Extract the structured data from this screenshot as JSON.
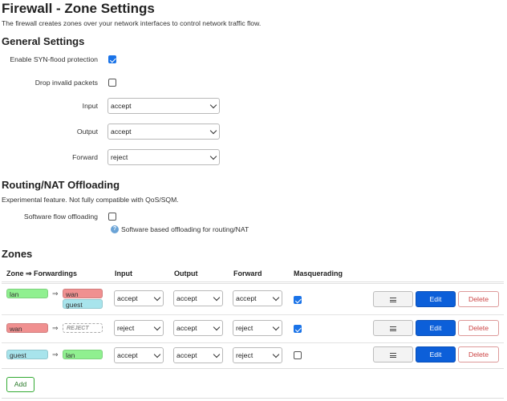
{
  "page": {
    "title": "Firewall - Zone Settings",
    "description": "The firewall creates zones over your network interfaces to control network traffic flow."
  },
  "general": {
    "heading": "General Settings",
    "syn_flood_label": "Enable SYN-flood protection",
    "syn_flood_checked": true,
    "drop_invalid_label": "Drop invalid packets",
    "drop_invalid_checked": false,
    "input_label": "Input",
    "input_value": "accept",
    "output_label": "Output",
    "output_value": "accept",
    "forward_label": "Forward",
    "forward_value": "reject"
  },
  "offloading": {
    "heading": "Routing/NAT Offloading",
    "note": "Experimental feature. Not fully compatible with QoS/SQM.",
    "flow_label": "Software flow offloading",
    "flow_checked": false,
    "hint": "Software based offloading for routing/NAT"
  },
  "zones": {
    "heading": "Zones",
    "headers": {
      "zone": "Zone ⇒ Forwardings",
      "input": "Input",
      "output": "Output",
      "forward": "Forward",
      "masq": "Masquerading"
    },
    "arrow": "⇒",
    "rows": [
      {
        "zone": "lan",
        "forwardings": [
          "wan",
          "guest"
        ],
        "input": "accept",
        "output": "accept",
        "forward": "accept",
        "masq": true
      },
      {
        "zone": "wan",
        "forwardings": [
          "REJECT"
        ],
        "input": "reject",
        "output": "accept",
        "forward": "reject",
        "masq": true
      },
      {
        "zone": "guest",
        "forwardings": [
          "lan"
        ],
        "input": "accept",
        "output": "accept",
        "forward": "reject",
        "masq": false
      }
    ],
    "edit_label": "Edit",
    "delete_label": "Delete",
    "add_label": "Add"
  },
  "colors": {
    "lan": "#90f090",
    "wan": "#f09090",
    "guest": "#a8e4ec",
    "accent": "#0c5fd9"
  }
}
